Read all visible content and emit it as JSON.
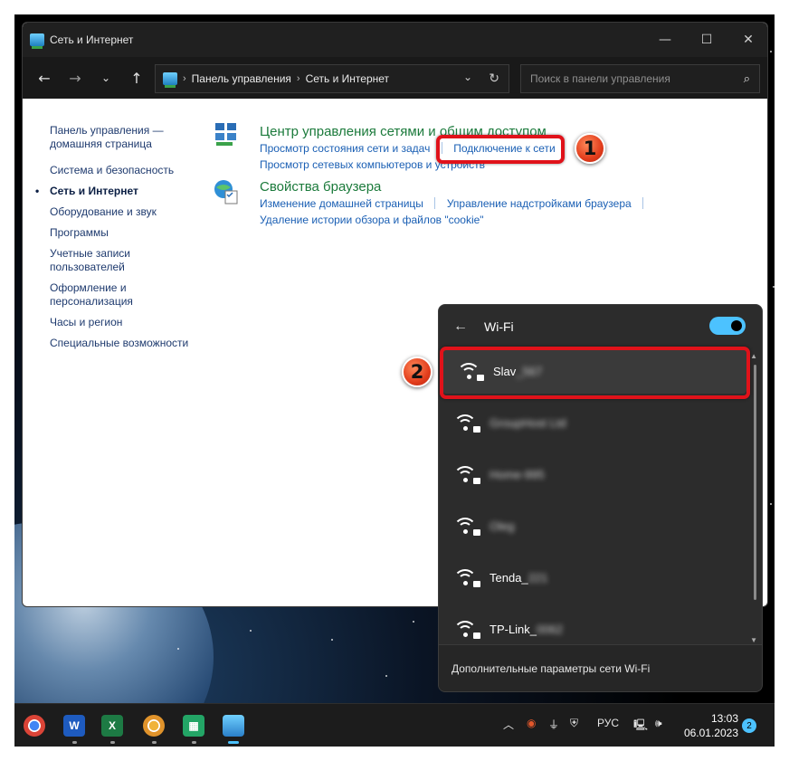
{
  "window": {
    "title": "Сеть и Интернет",
    "controls": {
      "minimize": "—",
      "maximize": "☐",
      "close": "✕"
    }
  },
  "nav": {
    "back_icon": "arrow-left-icon",
    "forward_icon": "arrow-right-icon",
    "recent_icon": "chevron-down-icon",
    "up_icon": "arrow-up-icon"
  },
  "address": {
    "crumbs": [
      "Панель управления",
      "Сеть и Интернет"
    ],
    "separator": "›"
  },
  "search": {
    "placeholder": "Поиск в панели управления"
  },
  "sidebar": {
    "items": [
      {
        "label": "Панель управления — домашняя страница",
        "current": false
      },
      {
        "label": "Система и безопасность",
        "current": false
      },
      {
        "label": "Сеть и Интернет",
        "current": true
      },
      {
        "label": "Оборудование и звук",
        "current": false
      },
      {
        "label": "Программы",
        "current": false
      },
      {
        "label": "Учетные записи пользователей",
        "current": false
      },
      {
        "label": "Оформление и персонализация",
        "current": false
      },
      {
        "label": "Часы и регион",
        "current": false
      },
      {
        "label": "Специальные возможности",
        "current": false
      }
    ]
  },
  "categories": [
    {
      "title": "Центр управления сетями и общим доступом",
      "icon": "network-center-icon",
      "links": [
        "Просмотр состояния сети и задач",
        "Подключение к сети",
        "Просмотр сетевых компьютеров и устройств"
      ]
    },
    {
      "title": "Свойства браузера",
      "icon": "browser-settings-icon",
      "links": [
        "Изменение домашней страницы",
        "Управление надстройками браузера",
        "Удаление истории обзора и файлов \"cookie\""
      ]
    }
  ],
  "annotations": {
    "badge1": "1",
    "badge2": "2"
  },
  "wifi": {
    "title": "Wi-Fi",
    "enabled": true,
    "networks": [
      {
        "name": "Slav",
        "hidden": "_567",
        "selected": true
      },
      {
        "name": "",
        "hidden": "GroupHost Ltd",
        "selected": false
      },
      {
        "name": "",
        "hidden": "Home-995",
        "selected": false
      },
      {
        "name": "",
        "hidden": "Oleg",
        "selected": false
      },
      {
        "name": "Tenda_",
        "hidden": "221",
        "selected": false
      },
      {
        "name": "TP-Link_",
        "hidden": "0062",
        "selected": false
      }
    ],
    "footer": "Дополнительные параметры сети Wi-Fi",
    "accent": "#4cc2ff"
  },
  "taskbar": {
    "apps": [
      "chrome-icon",
      "word-icon",
      "excel-icon",
      "chrome-canary-icon",
      "sheets-icon",
      "control-panel-icon"
    ],
    "app_letters": {
      "word": "W",
      "excel": "X",
      "sheets": "▦"
    },
    "language": "РУС",
    "time": "13:03",
    "date": "06.01.2023",
    "notifications": "2"
  },
  "colors": {
    "highlight": "#e0121a",
    "link": "#1a5fb4",
    "category_title": "#1b7a3b"
  }
}
